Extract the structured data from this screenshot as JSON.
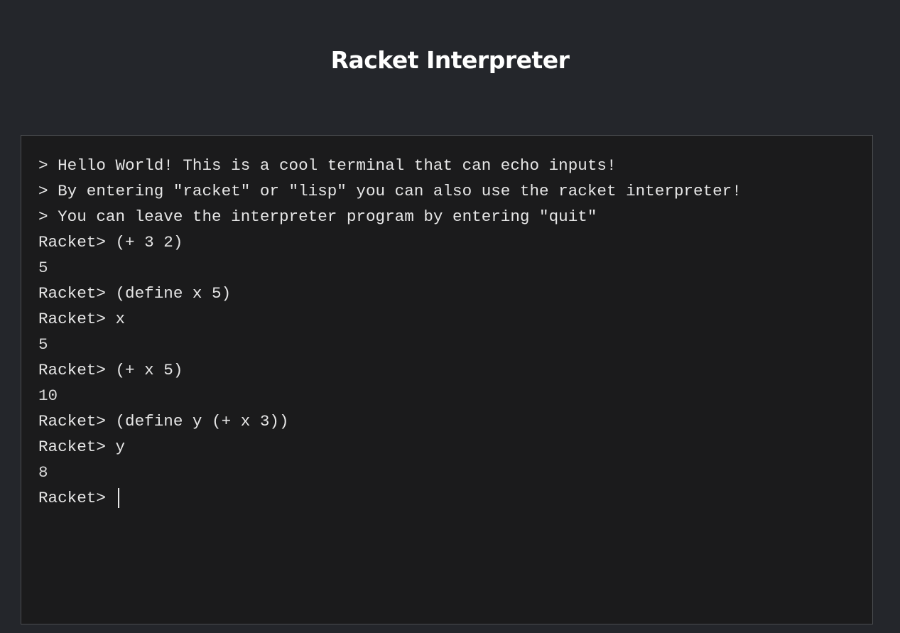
{
  "page": {
    "title": "Racket Interpreter"
  },
  "terminal": {
    "lines": [
      {
        "kind": "info",
        "text": "> Hello World! This is a cool terminal that can echo inputs!"
      },
      {
        "kind": "info",
        "text": "> By entering \"racket\" or \"lisp\" you can also use the racket interpreter!"
      },
      {
        "kind": "info",
        "text": "> You can leave the interpreter program by entering \"quit\""
      },
      {
        "kind": "command",
        "text": "Racket> (+ 3 2)"
      },
      {
        "kind": "output",
        "text": "5"
      },
      {
        "kind": "command",
        "text": "Racket> (define x 5)"
      },
      {
        "kind": "command",
        "text": "Racket> x"
      },
      {
        "kind": "output",
        "text": "5"
      },
      {
        "kind": "command",
        "text": "Racket> (+ x 5)"
      },
      {
        "kind": "output",
        "text": "10"
      },
      {
        "kind": "command",
        "text": "Racket> (define y (+ x 3))"
      },
      {
        "kind": "command",
        "text": "Racket> y"
      },
      {
        "kind": "output",
        "text": "8"
      }
    ],
    "prompt": "Racket> ",
    "input_value": ""
  },
  "colors": {
    "page_background": "#24262b",
    "terminal_background": "#1b1b1c",
    "terminal_border": "#4a4c50",
    "text": "#e6e6e6",
    "title": "#ffffff"
  }
}
